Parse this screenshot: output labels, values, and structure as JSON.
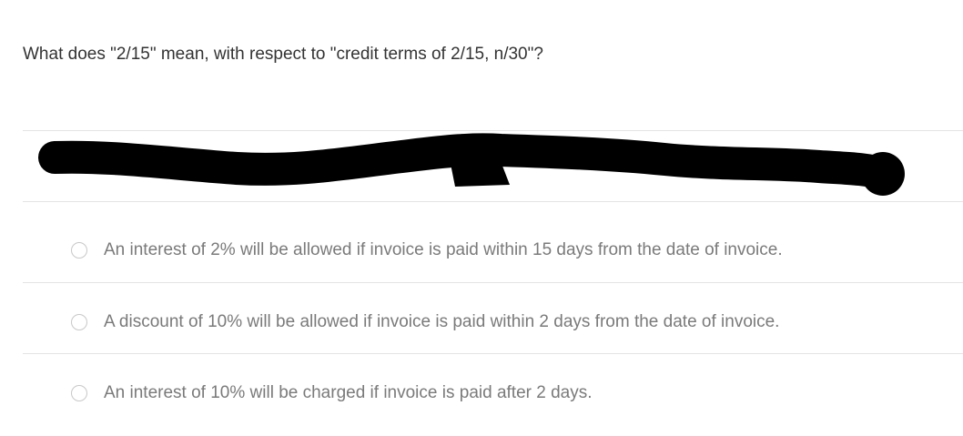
{
  "question": {
    "text": "What does \"2/15\" mean, with respect to \"credit terms of 2/15, n/30\"?"
  },
  "redacted_block": {
    "color": "#000000",
    "icon": "scribble-redaction"
  },
  "options": [
    {
      "label": "An interest of 2% will be allowed if invoice is paid within 15 days from the date of invoice.",
      "selected": false
    },
    {
      "label": "A discount of 10% will be allowed if invoice is paid within 2 days from the date of invoice.",
      "selected": false
    },
    {
      "label": "An interest of 10% will be charged if invoice is paid after 2 days.",
      "selected": false
    }
  ],
  "colors": {
    "question_text": "#333333",
    "option_text": "#7a7a7a",
    "divider": "#e4e4e4",
    "radio_border": "#c8c8c8"
  }
}
